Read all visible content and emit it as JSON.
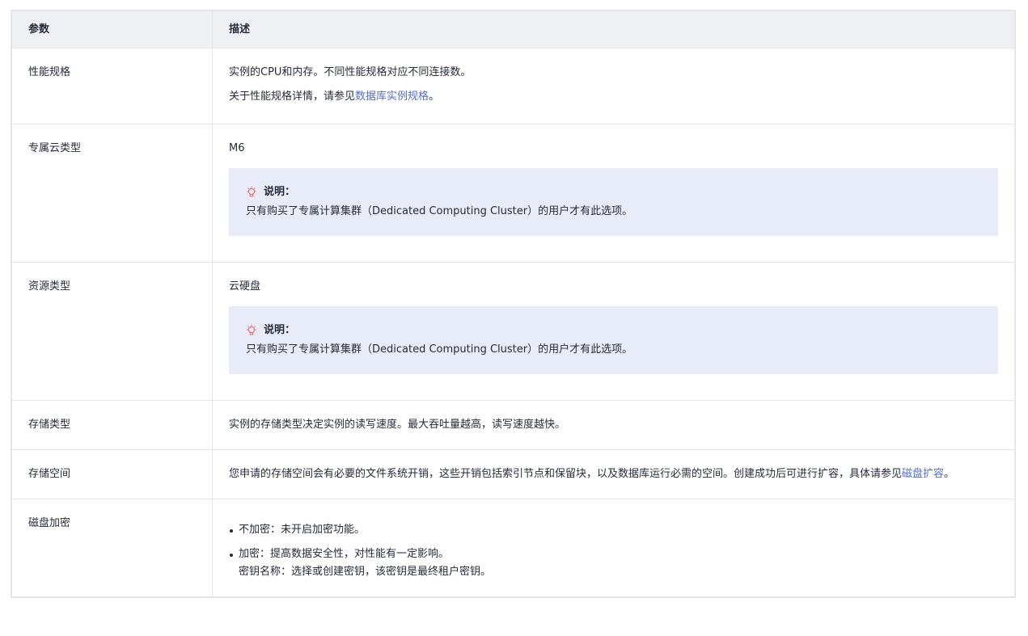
{
  "header": {
    "param": "参数",
    "desc": "描述"
  },
  "rows": [
    {
      "param": "性能规格",
      "lines": [
        "实例的CPU和内存。不同性能规格对应不同连接数。"
      ],
      "line2_prefix": "关于性能规格详情，请参见",
      "line2_link": "数据库实例规格",
      "line2_suffix": "。"
    },
    {
      "param": "专属云类型",
      "value": "M6",
      "note_title": "说明：",
      "note_text": "只有购买了专属计算集群（Dedicated Computing Cluster）的用户才有此选项。"
    },
    {
      "param": "资源类型",
      "value": "云硬盘",
      "note_title": "说明：",
      "note_text": "只有购买了专属计算集群（Dedicated Computing Cluster）的用户才有此选项。"
    },
    {
      "param": "存储类型",
      "text": "实例的存储类型决定实例的读写速度。最大吞吐量越高，读写速度越快。"
    },
    {
      "param": "存储空间",
      "text_prefix": "您申请的存储空间会有必要的文件系统开销，这些开销包括索引节点和保留块，以及数据库运行必需的空间。创建成功后可进行扩容，具体请参见",
      "link": "磁盘扩容",
      "text_suffix": "。"
    },
    {
      "param": "磁盘加密",
      "bullet1": "不加密：未开启加密功能。",
      "bullet2": "加密：提高数据安全性，对性能有一定影响。",
      "bullet2_sub": "密钥名称：选择或创建密钥，该密钥是最终租户密钥。"
    }
  ],
  "icons": {
    "note": "lightbulb-icon"
  },
  "colors": {
    "link": "#526ecc",
    "note_bg": "#e8ecf9",
    "header_bg": "#eff0f3",
    "note_icon": "#e8706a"
  }
}
